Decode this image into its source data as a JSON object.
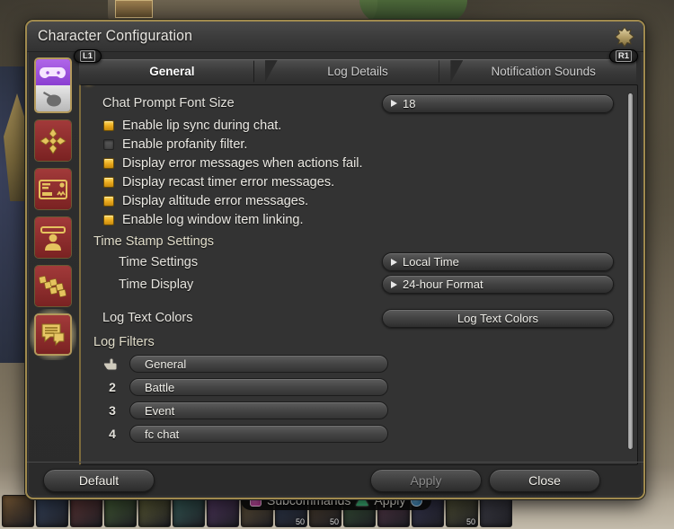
{
  "window": {
    "title": "Character Configuration",
    "close_icon": "close-star-icon"
  },
  "sidebar": {
    "items": [
      {
        "name": "controls-gamepad-mouse",
        "icon": "gamepad-mouse-icon",
        "active": false
      },
      {
        "name": "movement-settings",
        "icon": "four-way-arrow-icon",
        "active": false
      },
      {
        "name": "hud-settings",
        "icon": "hud-card-icon",
        "active": false
      },
      {
        "name": "name-display-settings",
        "icon": "character-name-icon",
        "active": false
      },
      {
        "name": "hotbar-settings",
        "icon": "hotbar-blocks-icon",
        "active": false
      },
      {
        "name": "log-window-settings",
        "icon": "chat-log-icon",
        "active": true
      }
    ]
  },
  "bumpers": {
    "left": "L1",
    "right": "R1"
  },
  "tabs": [
    {
      "label": "General",
      "selected": true
    },
    {
      "label": "Log Details",
      "selected": false
    },
    {
      "label": "Notification Sounds",
      "selected": false
    }
  ],
  "general": {
    "font_size": {
      "label": "Chat Prompt Font Size",
      "value": "18"
    },
    "checkboxes": [
      {
        "label": "Enable lip sync during chat.",
        "checked": true
      },
      {
        "label": "Enable profanity filter.",
        "checked": false
      },
      {
        "label": "Display error messages when actions fail.",
        "checked": true
      },
      {
        "label": "Display recast timer error messages.",
        "checked": true
      },
      {
        "label": "Display altitude error messages.",
        "checked": true
      },
      {
        "label": "Enable log window item linking.",
        "checked": true
      }
    ],
    "timestamp": {
      "heading": "Time Stamp Settings",
      "rows": [
        {
          "label": "Time Settings",
          "value": "Local Time"
        },
        {
          "label": "Time Display",
          "value": "24-hour Format"
        }
      ]
    },
    "log_text_colors": {
      "label": "Log Text Colors",
      "button": "Log Text Colors"
    },
    "log_filters": {
      "heading": "Log Filters",
      "rows": [
        {
          "key": "1",
          "key_icon": "pointing-hand-icon",
          "label": "General"
        },
        {
          "key": "2",
          "key_icon": null,
          "label": "Battle"
        },
        {
          "key": "3",
          "key_icon": null,
          "label": "Event"
        },
        {
          "key": "4",
          "key_icon": null,
          "label": "fc chat"
        }
      ]
    }
  },
  "footer": {
    "default": "Default",
    "apply": "Apply",
    "apply_enabled": false,
    "close": "Close"
  },
  "game_hud": {
    "commands": [
      {
        "button": "square",
        "label": "Subcommands"
      },
      {
        "button": "triangle",
        "label": "Apply"
      },
      {
        "button": "circle",
        "label": ""
      }
    ],
    "hotbar_numbers": [
      "",
      "",
      "",
      "",
      "",
      "",
      "",
      "",
      "50",
      "50",
      "",
      "",
      "",
      "50",
      ""
    ]
  },
  "colors": {
    "window_border": "#a08a4e",
    "panel_bg": "#333333",
    "checkbox_on": "#e9a81c",
    "accent_gold": "#d19b18",
    "active_glow": "#fff5cd"
  }
}
